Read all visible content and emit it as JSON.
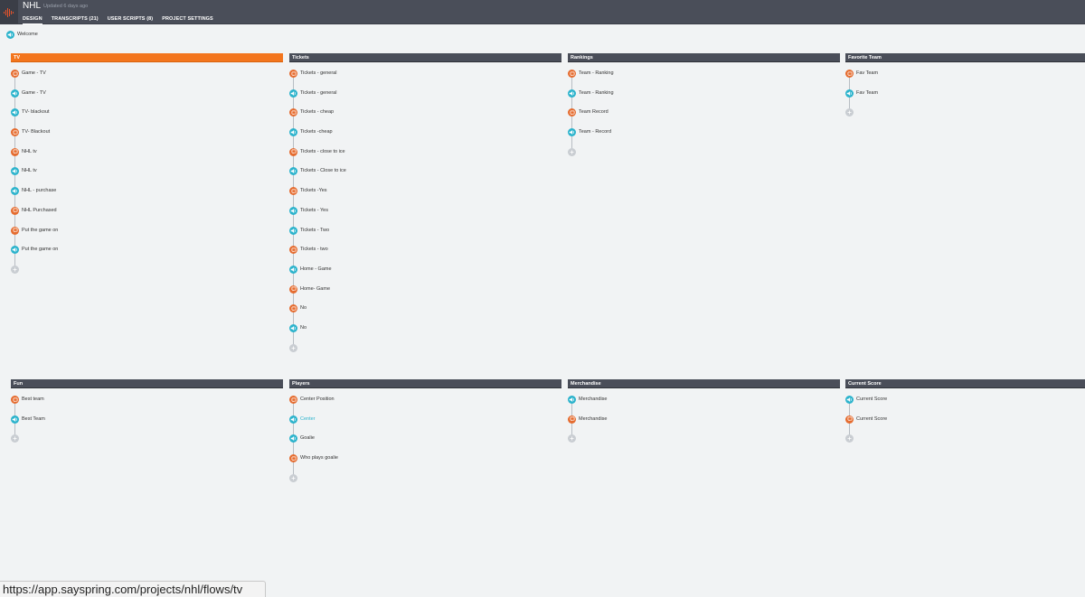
{
  "app": {
    "title": "NHL",
    "updated": "Updated 6 days ago",
    "tabs": [
      {
        "label": "DESIGN",
        "active": true
      },
      {
        "label": "TRANSCRIPTS (21)",
        "active": false
      },
      {
        "label": "USER SCRIPTS (8)",
        "active": false
      },
      {
        "label": "PROJECT SETTINGS",
        "active": false
      }
    ]
  },
  "colors": {
    "user_node": "#e56b2e",
    "app_node": "#2bb3cc",
    "active_header": "#f3751d",
    "header": "#4a4e59"
  },
  "welcome": {
    "label": "Welcome",
    "kind": "app"
  },
  "groups": [
    {
      "title": "TV",
      "active": true,
      "items": [
        {
          "label": "Game - TV",
          "kind": "user"
        },
        {
          "label": "Game - TV",
          "kind": "app"
        },
        {
          "label": "TV- blackout",
          "kind": "app"
        },
        {
          "label": "TV- Blackout",
          "kind": "user"
        },
        {
          "label": "NHL tv",
          "kind": "user"
        },
        {
          "label": "NHL tv",
          "kind": "app"
        },
        {
          "label": "NHL - purchase",
          "kind": "app"
        },
        {
          "label": "NHL Purchased",
          "kind": "user"
        },
        {
          "label": "Put the game on",
          "kind": "user"
        },
        {
          "label": "Put the game on",
          "kind": "app"
        }
      ]
    },
    {
      "title": "Tickets",
      "active": false,
      "items": [
        {
          "label": "Tickets - general",
          "kind": "user"
        },
        {
          "label": "Tickets - general",
          "kind": "app"
        },
        {
          "label": "Tickets - cheap",
          "kind": "user"
        },
        {
          "label": "Tickets -cheap",
          "kind": "app"
        },
        {
          "label": "Tickets - close to ice",
          "kind": "user"
        },
        {
          "label": "Tickets - Close to ice",
          "kind": "app"
        },
        {
          "label": "Tickets -Yes",
          "kind": "user"
        },
        {
          "label": "Tickets - Yes",
          "kind": "app"
        },
        {
          "label": "Tickets - Two",
          "kind": "app"
        },
        {
          "label": "Tickets - two",
          "kind": "user"
        },
        {
          "label": "Home - Game",
          "kind": "app"
        },
        {
          "label": "Home- Game",
          "kind": "user"
        },
        {
          "label": "No",
          "kind": "user"
        },
        {
          "label": "No",
          "kind": "app"
        }
      ]
    },
    {
      "title": "Rankings",
      "active": false,
      "items": [
        {
          "label": "Team - Ranking",
          "kind": "user"
        },
        {
          "label": "Team - Ranking",
          "kind": "app"
        },
        {
          "label": "Team Record",
          "kind": "user"
        },
        {
          "label": "Team - Record",
          "kind": "app"
        }
      ]
    },
    {
      "title": "Favorite Team",
      "active": false,
      "items": [
        {
          "label": "Fav Team",
          "kind": "user"
        },
        {
          "label": "Fav Team",
          "kind": "app"
        }
      ]
    },
    {
      "title": "Fun",
      "active": false,
      "items": [
        {
          "label": "Best team",
          "kind": "user"
        },
        {
          "label": "Best Team",
          "kind": "app"
        }
      ]
    },
    {
      "title": "Players",
      "active": false,
      "items": [
        {
          "label": "Center Position",
          "kind": "user"
        },
        {
          "label": "Center",
          "kind": "app",
          "highlight": true
        },
        {
          "label": "Goalie",
          "kind": "app"
        },
        {
          "label": "Who plays goalie",
          "kind": "user"
        }
      ]
    },
    {
      "title": "Merchandise",
      "active": false,
      "items": [
        {
          "label": "Merchandise",
          "kind": "app"
        },
        {
          "label": "Merchandise",
          "kind": "user"
        }
      ]
    },
    {
      "title": "Current Score",
      "active": false,
      "items": [
        {
          "label": "Current Score",
          "kind": "app"
        },
        {
          "label": "Current Score",
          "kind": "user"
        }
      ]
    }
  ],
  "status_url": "https://app.sayspring.com/projects/nhl/flows/tv"
}
